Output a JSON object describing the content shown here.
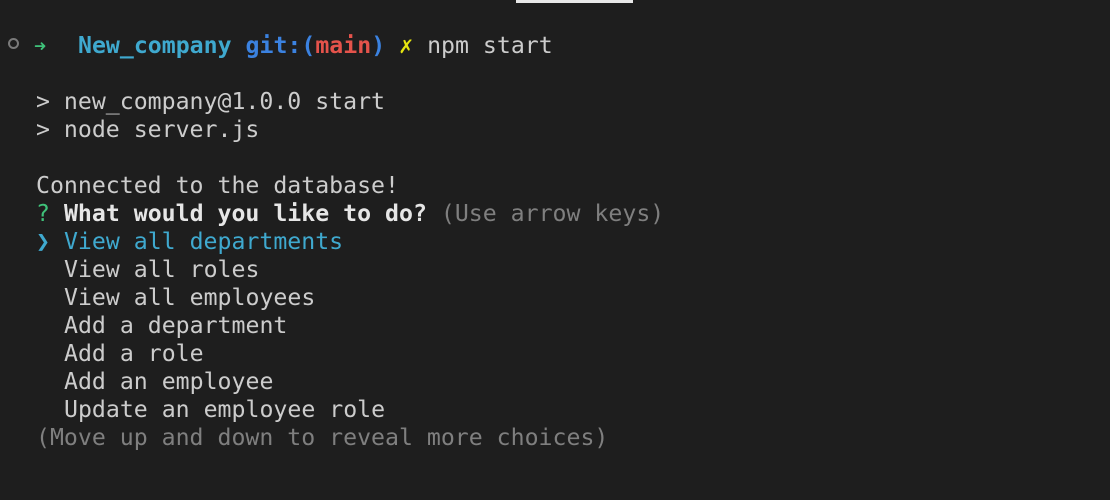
{
  "prompt": {
    "directory": "New_company",
    "git_prefix": "git:(",
    "branch": "main",
    "git_suffix": ")",
    "dirty_marker": "✗",
    "command": "npm start"
  },
  "output": {
    "script_line1": "> new_company@1.0.0 start",
    "script_line2": "> node server.js",
    "connected": "Connected to the database!"
  },
  "question": {
    "marker": "?",
    "text": "What would you like to do?",
    "hint": "(Use arrow keys)"
  },
  "menu": {
    "pointer": "❯",
    "choices": [
      "View all departments",
      "View all roles",
      "View all employees",
      "Add a department",
      "Add a role",
      "Add an employee",
      "Update an employee role"
    ],
    "selected_index": 0,
    "footer": "(Move up and down to reveal more choices)"
  },
  "colors": {
    "background": "#1e1e1e",
    "directory": "#3fa9cf",
    "branch": "#e5534b",
    "selected": "#3fa9cf"
  }
}
